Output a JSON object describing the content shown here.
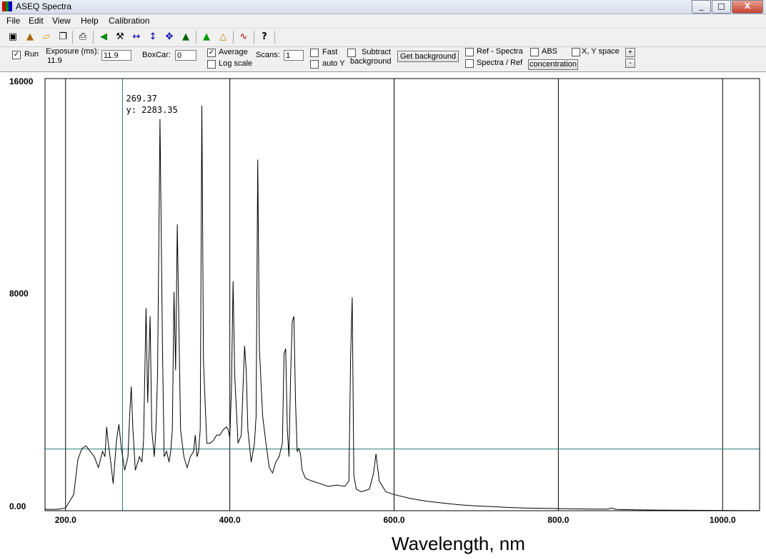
{
  "window": {
    "title": "ASEQ Spectra",
    "min": "_",
    "max": "□",
    "close": "X"
  },
  "menu": [
    "File",
    "Edit",
    "View",
    "Help",
    "Calibration"
  ],
  "toolbar": {
    "icons": [
      "save-icon",
      "export-icon",
      "open-icon",
      "copy-icon",
      "print-icon",
      "left-arrow-icon",
      "wrench-icon",
      "horizontal-zoom-icon",
      "vertical-zoom-icon",
      "pan-icon",
      "autoscale-icon",
      "peak-up-icon",
      "folder-up-icon",
      "spectrum-icon",
      "help-icon"
    ],
    "help_glyph": "?"
  },
  "controls": {
    "run_label": "Run",
    "run_checked": true,
    "exposure_label": "Exposure (ms):",
    "exposure_readout": "11.9",
    "exposure_value": "11.9",
    "boxcar_label": "BoxCar:",
    "boxcar_value": "0",
    "average_label": "Average",
    "average_checked": true,
    "logscale_label": "Log scale",
    "scans_label": "Scans:",
    "scans_value": "1",
    "fast_label": "Fast",
    "autoy_label": "auto Y",
    "subtract_label": "Subtract",
    "background_label": "background",
    "get_background_label": "Get background",
    "ref_spectra_label": "Ref - Spectra",
    "spectra_ref_label": "Spectra / Ref",
    "abs_label": "ABS",
    "concentration_label": "concentration",
    "xy_space_label": "X, Y space",
    "plus_label": "+",
    "minus_label": "-"
  },
  "chart_data": {
    "type": "line",
    "xlabel": "Wavelength, nm",
    "xlim": [
      175,
      1045
    ],
    "ylim": [
      0,
      16000
    ],
    "xticks": [
      "200.0",
      "400.0",
      "600.0",
      "800.0",
      "1000.0"
    ],
    "yticks": [
      "0.00",
      "8000",
      "16000"
    ],
    "line_color": "#000000",
    "grid_color": "#000000",
    "cursor_color": "#2a7a7a",
    "cursor": {
      "x_label": "269.37",
      "y_label": "y: 2283.35",
      "x": 269.37,
      "y": 2283.35
    },
    "series": [
      {
        "x": [
          175,
          190,
          200,
          210,
          215,
          220,
          225,
          230,
          235,
          240,
          245,
          248,
          250,
          252,
          255,
          258,
          262,
          265,
          268,
          272,
          276,
          278,
          280,
          282,
          285,
          290,
          293,
          295,
          298,
          300,
          303,
          305,
          308,
          310,
          312,
          315,
          318,
          320,
          323,
          326,
          328,
          330,
          332,
          334,
          336,
          340,
          344,
          348,
          352,
          356,
          358,
          360,
          362,
          364,
          366,
          368,
          372,
          376,
          380,
          384,
          388,
          392,
          396,
          398,
          400,
          402,
          404,
          406,
          410,
          414,
          416,
          418,
          420,
          422,
          426,
          430,
          432,
          434,
          436,
          440,
          444,
          448,
          452,
          456,
          460,
          464,
          466,
          468,
          470,
          472,
          474,
          476,
          478,
          480,
          482,
          484,
          486,
          488,
          492,
          500,
          510,
          520,
          530,
          540,
          545,
          547,
          549,
          551,
          554,
          560,
          570,
          575,
          578,
          582,
          590,
          600,
          620,
          640,
          660,
          680,
          700,
          720,
          740,
          760,
          780,
          800,
          820,
          840,
          860,
          865,
          870,
          880,
          900,
          920,
          940,
          960,
          980,
          1000,
          1020,
          1045
        ],
        "y": [
          50,
          50,
          100,
          600,
          1900,
          2300,
          2400,
          2200,
          2000,
          1600,
          2200,
          2000,
          3100,
          2500,
          1800,
          1000,
          2600,
          3200,
          2300,
          1500,
          2000,
          3500,
          4600,
          3000,
          1500,
          2000,
          1800,
          2600,
          7500,
          4000,
          7200,
          3000,
          2000,
          3000,
          5000,
          14500,
          6000,
          2000,
          2200,
          1800,
          2200,
          3000,
          8100,
          5200,
          10600,
          3000,
          2000,
          1600,
          2000,
          2200,
          2800,
          2000,
          2200,
          3000,
          15000,
          5500,
          2500,
          2500,
          2600,
          2800,
          2800,
          3000,
          3100,
          3000,
          2700,
          4500,
          8500,
          5000,
          2500,
          2800,
          4500,
          6100,
          5200,
          3000,
          1800,
          2500,
          3500,
          13000,
          6000,
          3500,
          2500,
          1600,
          1400,
          1800,
          2000,
          2500,
          5800,
          6000,
          3000,
          2000,
          5000,
          7000,
          7200,
          4000,
          2200,
          2300,
          2100,
          1500,
          1200,
          1100,
          1000,
          900,
          950,
          900,
          1100,
          5600,
          7900,
          1300,
          800,
          700,
          800,
          1400,
          2100,
          1100,
          700,
          600,
          450,
          350,
          280,
          220,
          180,
          150,
          120,
          100,
          90,
          80,
          70,
          60,
          60,
          100,
          50,
          40,
          30,
          25,
          20,
          15,
          12,
          10,
          8,
          5
        ]
      }
    ]
  }
}
